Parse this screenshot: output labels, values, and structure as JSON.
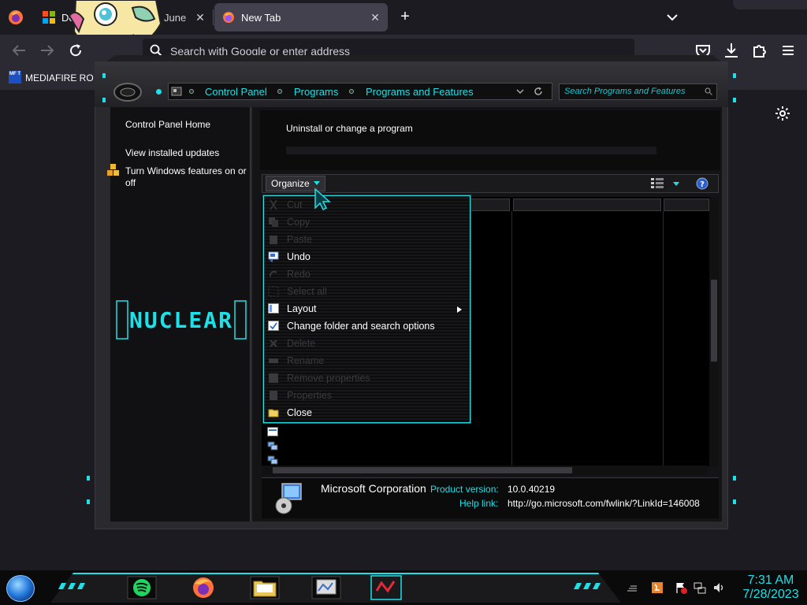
{
  "browser": {
    "tabs": [
      {
        "label": "De",
        "favicon": "microsoft-icon",
        "close": "✕"
      },
      {
        "label": "New Tab",
        "favicon": "firefox-icon",
        "close": "✕"
      }
    ],
    "tab1_extra": "June",
    "new_tab": "+",
    "url_placeholder": "Search with Google or enter address",
    "bookmarks": [
      {
        "label": "MEDIAFIRE RO",
        "icon_text": "MF T"
      }
    ]
  },
  "explorer": {
    "breadcrumb": [
      "Control Panel",
      "Programs",
      "Programs and Features"
    ],
    "search_placeholder": "Search Programs and Features",
    "left_links": [
      "Control Panel Home",
      "View installed updates",
      "Turn Windows features on or off"
    ],
    "title": "Uninstall or change a program",
    "toolbar": {
      "organize": "Organize"
    },
    "menu": [
      {
        "label": "Cut",
        "enabled": false,
        "icon": "cut-icon"
      },
      {
        "label": "Copy",
        "enabled": false,
        "icon": "copy-icon"
      },
      {
        "label": "Paste",
        "enabled": false,
        "icon": "paste-icon"
      },
      {
        "label": "Undo",
        "enabled": true,
        "icon": "undo-icon"
      },
      {
        "label": "Redo",
        "enabled": false,
        "icon": "redo-icon"
      },
      {
        "label": "Select all",
        "enabled": false,
        "icon": "select-all-icon"
      },
      {
        "label": "Layout",
        "enabled": true,
        "icon": "layout-icon",
        "submenu": true
      },
      {
        "label": "Change folder and search options",
        "enabled": true,
        "icon": "folder-options-icon"
      },
      {
        "label": "Delete",
        "enabled": false,
        "icon": "delete-icon"
      },
      {
        "label": "Rename",
        "enabled": false,
        "icon": "rename-icon"
      },
      {
        "label": "Remove properties",
        "enabled": false,
        "icon": "remove-properties-icon"
      },
      {
        "label": "Properties",
        "enabled": false,
        "icon": "properties-icon"
      },
      {
        "label": "Close",
        "enabled": true,
        "icon": "close-folder-icon"
      }
    ],
    "details": {
      "name": "Microsoft Corporation",
      "product_version_label": "Product version:",
      "product_version": "10.0.40219",
      "help_link_label": "Help link:",
      "help_link": "http://go.microsoft.com/fwlink/?LinkId=146008"
    },
    "logo_text": "NUCLEAR"
  },
  "taskbar": {
    "time": "7:31 AM",
    "date": "7/28/2023"
  },
  "colors": {
    "accent": "#1ee0e6",
    "chrome_bg": "#1c1b22",
    "toolbar_bg": "#2b2a33"
  }
}
